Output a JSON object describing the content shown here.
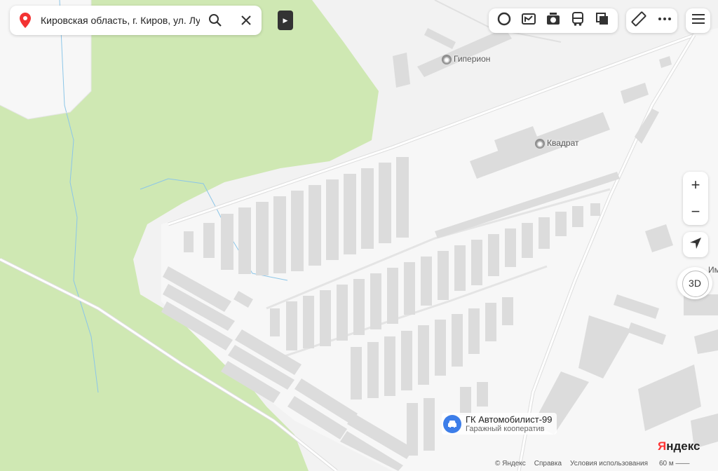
{
  "search": {
    "address": "Кировская область, г. Киров, ул. Луга"
  },
  "labels": {
    "hyperion": "Гиперион",
    "kvadrat": "Квадрат",
    "edge": "Им"
  },
  "organization": {
    "name": "ГК Автомобилист-99",
    "category": "Гаражный кооператив"
  },
  "zoom": {
    "in": "+",
    "out": "−"
  },
  "mode3d": "3D",
  "footer": {
    "copyright": "© Яндекс",
    "help": "Справка",
    "terms": "Условия использования"
  },
  "scale": {
    "label": "60 м"
  },
  "logo": {
    "first": "Я",
    "rest": "ндекс"
  },
  "colors": {
    "forest": "#cfe8b3",
    "background": "#f2f2f2",
    "building": "#dcdcdc",
    "road": "#ffffff",
    "accent": "#3d7ee9",
    "pin": "#f33333"
  },
  "icons": [
    "location-pin-icon",
    "search-icon",
    "close-icon",
    "panorama-icon",
    "traffic-icon",
    "camera-icon",
    "bus-icon",
    "layers-icon",
    "ruler-icon",
    "more-icon",
    "menu-icon",
    "locate-icon"
  ]
}
